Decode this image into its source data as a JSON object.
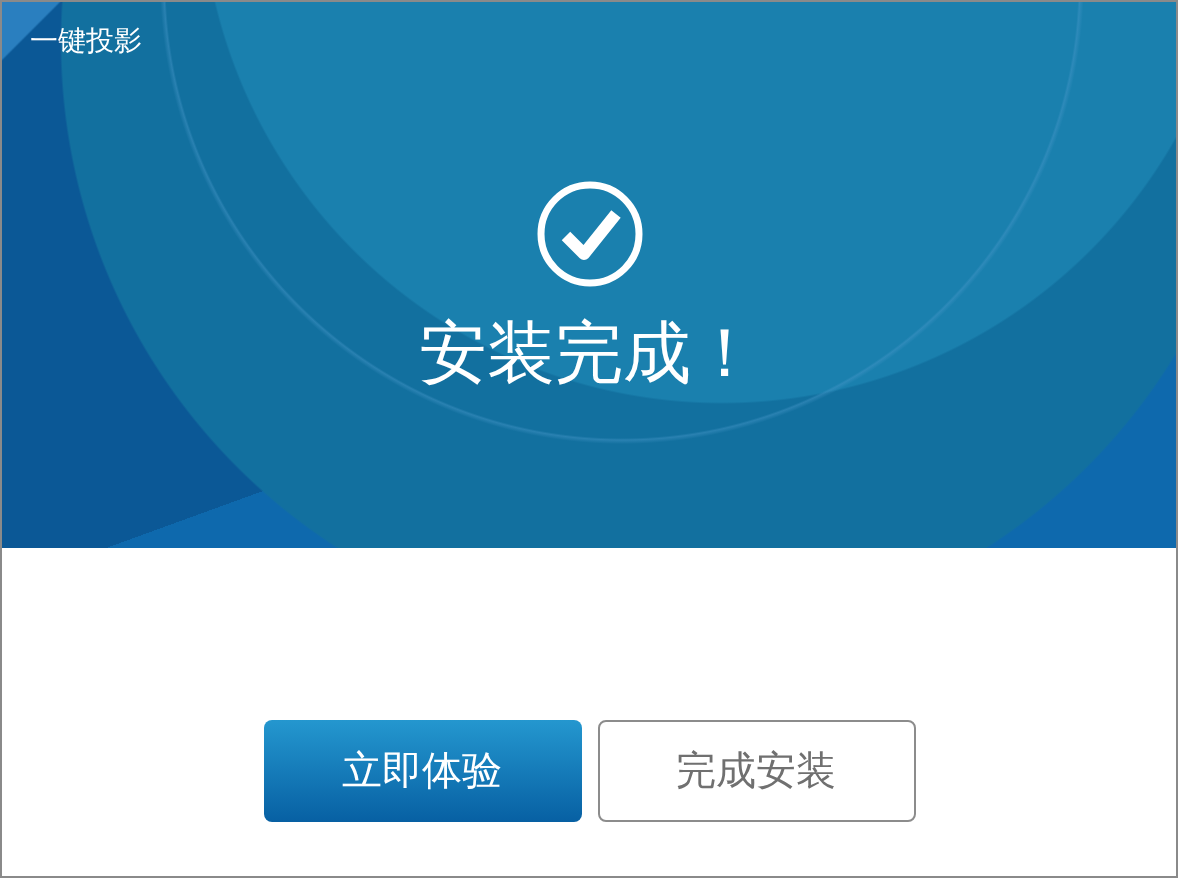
{
  "window": {
    "title": "一键投影"
  },
  "status": {
    "message": "安装完成！"
  },
  "buttons": [
    {
      "label": "立即体验",
      "kind": "primary"
    },
    {
      "label": "完成安装",
      "kind": "secondary"
    }
  ]
}
